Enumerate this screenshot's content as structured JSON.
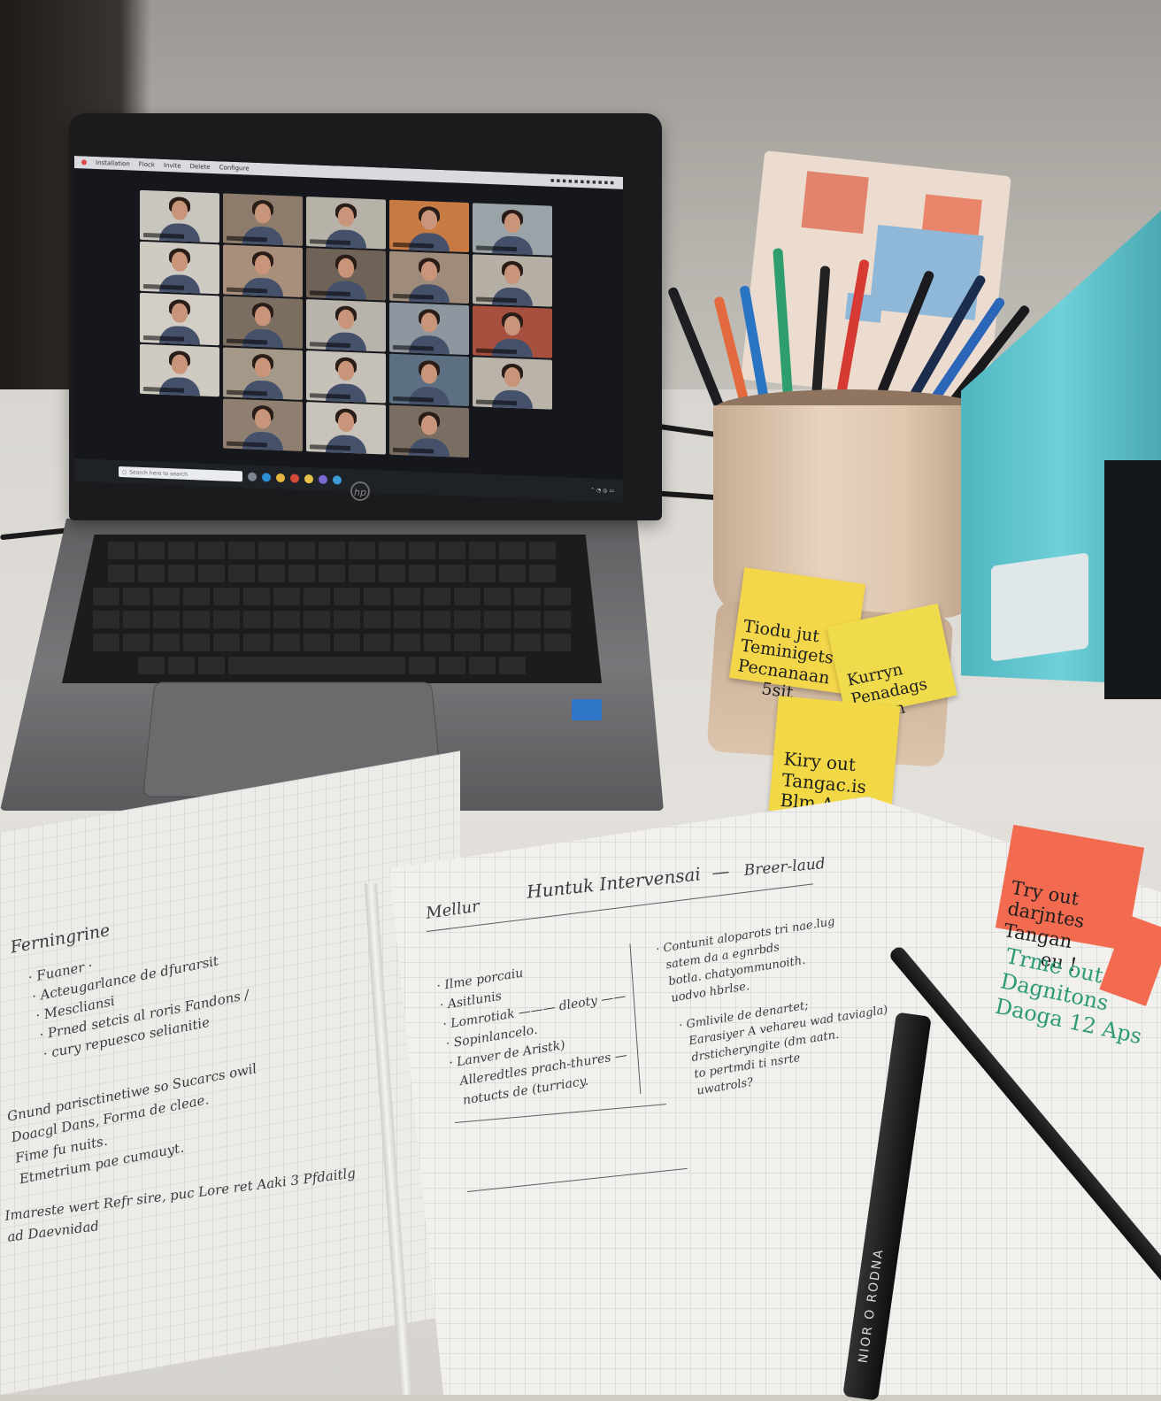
{
  "laptop": {
    "brand": "hp",
    "menu_bar": [
      "Installation",
      "Flock",
      "Invite",
      "Delete",
      "Configure"
    ],
    "taskbar_search": "Search here to search"
  },
  "video_call": {
    "participant_count": 23,
    "tile_colors": [
      "#c9c6c0",
      "#8d7b6c",
      "#b7b2a8",
      "#c77b43",
      "#9aa3a8",
      "#cfcbc3",
      "#a88f7c",
      "#6f6357",
      "#9e8b7a",
      "#b5afa5",
      "#d2cdc5",
      "#7d6e62",
      "#b9b4ab",
      "#8e96a0",
      "#a7503f",
      "#cfcac2",
      "#a49888",
      "#c6c1b8",
      "#5c6f83",
      "#b9b3a9",
      "#8f7f70",
      "#c8c3ba",
      "#7a6d62"
    ]
  },
  "sticky_notes": {
    "yellow_top": "Tiodu jut\nTeminigets\nPecnanaan\n     5sit",
    "yellow_mid": "Kurryn\nPenadags\n   Pien",
    "yellow_low": "Kiry out\nTangac.is\nBlm Aasi.\n        Tu. R",
    "orange": "Try out\ndarjntes\nTangan\n       eu !"
  },
  "green_note": "Trme out\nDagnitons\nDaoga 12 Aps",
  "notebook": {
    "left_page": {
      "heading": "Ferningrine",
      "bullets": [
        "· Fuaner ·",
        "· Acteugarlance de dfurarsit",
        "· Mescliansi",
        "· Prned setcis al roris Fandons /",
        "· cury repuesco selianitie"
      ],
      "paragraph": [
        "Gnund parisctinetiwe so Sucarcs owil",
        "Doacgl Dans, Forma de cleae.",
        "Fime fu nuits.",
        "Etmetrium pae cumauyt."
      ],
      "footer": [
        "Imareste wert Refr sire, puc Lore ret Aaki 3 Pfdaitlg",
        "ad Daevnidad"
      ]
    },
    "right_page": {
      "top_left": "Mellur",
      "title": "Huntuk Intervensai  —",
      "top_right": "Breer-laud",
      "bullets_left": [
        "· Ilme porcaiu",
        "· Asitlunis",
        "· Lomrotiak ——— dleoty ——",
        "· Sopinlancelo.",
        "· Lanver de Aristk)",
        "  Alleredtles prach-thures —",
        "  notucts de (turriacy."
      ],
      "bullets_right_1": [
        "· Contunit aloparots tri nae.lug",
        "  satem da a egnrbds",
        "  botla. chatyommunoith.",
        "  uodvo hbrlse."
      ],
      "bullets_right_2": [
        "· Gmlivile de denartet;",
        "  Earasiyer A vehareu wad taviagla)",
        "  drsticheryngite (dm aatn.",
        "  to pertmdi ti nsrte",
        "  uwatrols?"
      ]
    }
  },
  "marker_label": "NIOR O RODNA"
}
